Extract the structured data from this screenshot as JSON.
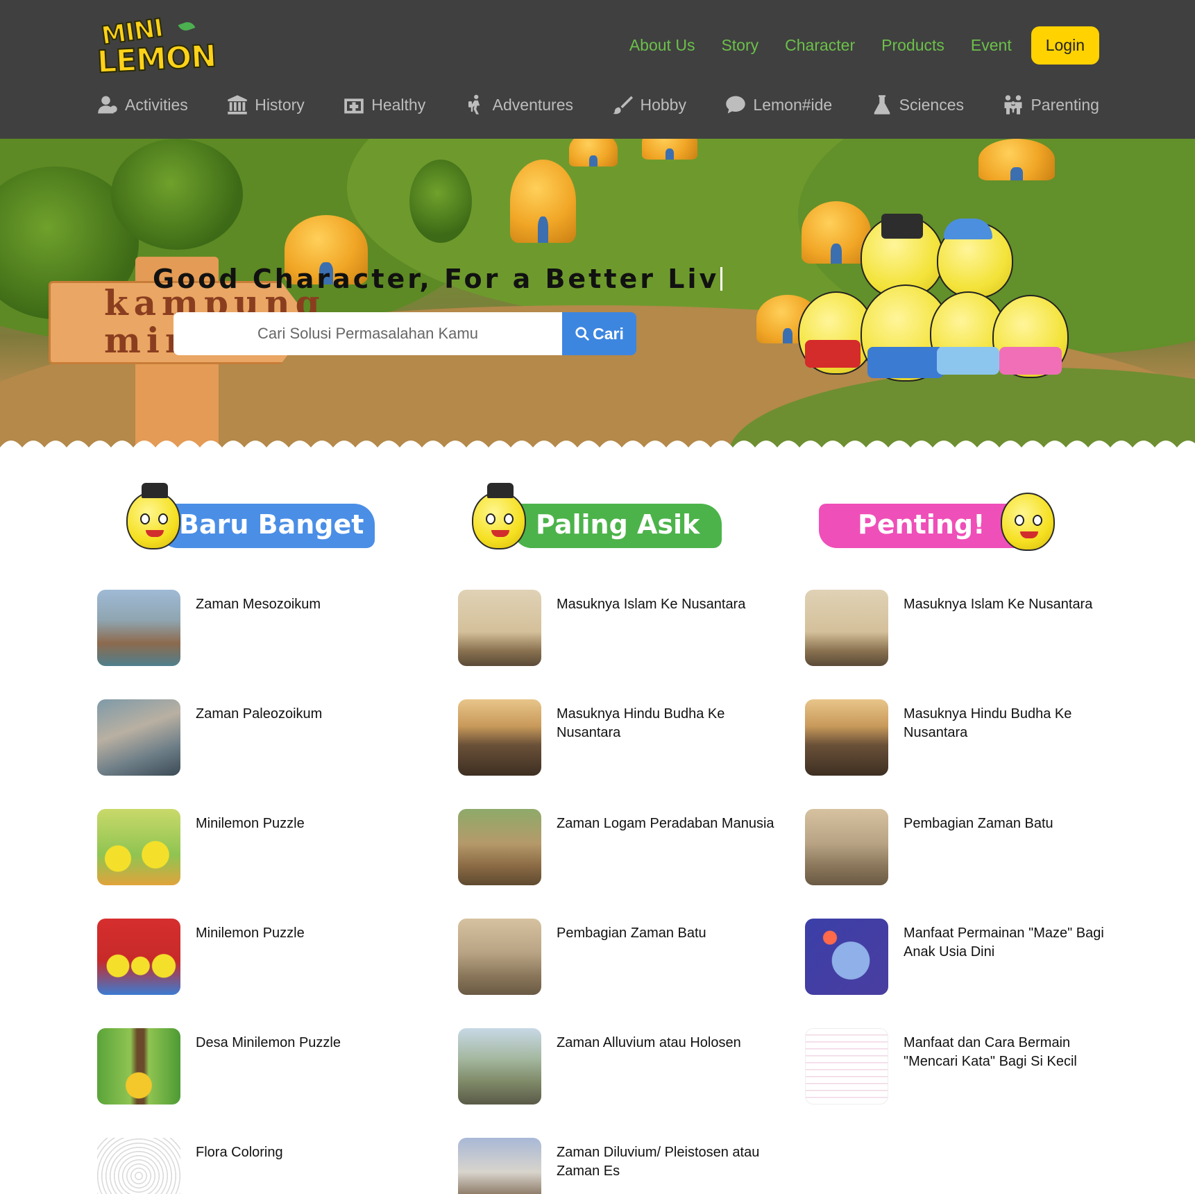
{
  "brand": {
    "logo_line1": "MINI",
    "logo_line2": "LEMON"
  },
  "topnav": [
    "About Us",
    "Story",
    "Character",
    "Products",
    "Event"
  ],
  "login_label": "Login",
  "categories": [
    {
      "label": "Activities",
      "icon": "user-icon"
    },
    {
      "label": "History",
      "icon": "museum-icon"
    },
    {
      "label": "Healthy",
      "icon": "medkit-icon"
    },
    {
      "label": "Adventures",
      "icon": "hiker-icon"
    },
    {
      "label": "Hobby",
      "icon": "brush-icon"
    },
    {
      "label": "Lemon#ide",
      "icon": "chat-icon"
    },
    {
      "label": "Sciences",
      "icon": "flask-icon"
    },
    {
      "label": "Parenting",
      "icon": "family-icon"
    }
  ],
  "hero": {
    "title": "Good Character, For a Better Liv",
    "sign_text": "kampung mini",
    "search_placeholder": "Cari Solusi Permasalahan Kamu",
    "search_button": "Cari"
  },
  "colors": {
    "header_bg": "#404040",
    "nav_green": "#6cc04a",
    "login_yellow": "#ffd200",
    "search_blue": "#3d86e0",
    "banner_blue": "#4a8ee6",
    "banner_green": "#4cb34a",
    "banner_pink": "#ef4fb8"
  },
  "sections": [
    {
      "title": "Baru Banget",
      "items": [
        "Zaman Mesozoikum",
        "Zaman Paleozoikum",
        "Minilemon Puzzle",
        "Minilemon Puzzle",
        "Desa Minilemon Puzzle",
        "Flora Coloring"
      ]
    },
    {
      "title": "Paling Asik",
      "items": [
        "Masuknya Islam Ke Nusantara",
        "Masuknya Hindu Budha Ke Nusantara",
        "Zaman Logam Peradaban Manusia",
        "Pembagian Zaman Batu",
        "Zaman Alluvium atau Holosen",
        "Zaman Diluvium/ Pleistosen atau Zaman Es"
      ]
    },
    {
      "title": "Penting!",
      "items": [
        "Masuknya Islam Ke Nusantara",
        "Masuknya Hindu Budha Ke Nusantara",
        "Pembagian Zaman Batu",
        "Manfaat Permainan \"Maze\" Bagi Anak Usia Dini",
        "Manfaat dan Cara Bermain \"Mencari Kata\" Bagi Si Kecil"
      ]
    }
  ]
}
